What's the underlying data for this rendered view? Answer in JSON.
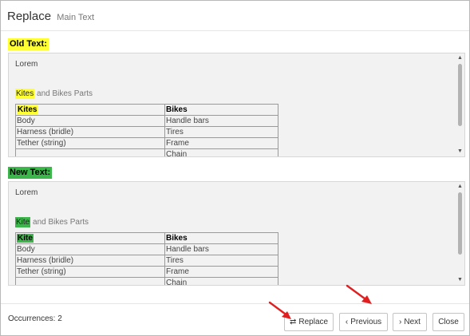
{
  "dialog": {
    "title": "Replace",
    "subtitle": "Main Text"
  },
  "old_section": {
    "label": "Old Text:",
    "lorem": "Lorem",
    "highlight_word": "Kites",
    "rest_text": " and Bikes Parts",
    "table": {
      "header": [
        "Kites",
        "Bikes"
      ],
      "rows": [
        [
          "Body",
          "Handle bars"
        ],
        [
          "Harness (bridle)",
          "Tires"
        ],
        [
          "Tether (string)",
          "Frame"
        ],
        [
          "",
          "Chain"
        ]
      ]
    }
  },
  "new_section": {
    "label": "New Text:",
    "lorem": "Lorem",
    "highlight_word": "Kite",
    "rest_text": " and Bikes Parts",
    "table": {
      "header": [
        "Kite",
        "Bikes"
      ],
      "rows": [
        [
          "Body",
          "Handle bars"
        ],
        [
          "Harness (bridle)",
          "Tires"
        ],
        [
          "Tether (string)",
          "Frame"
        ],
        [
          "",
          "Chain"
        ]
      ]
    }
  },
  "footer": {
    "occurrences": "Occurrences: 2",
    "replace_label": "Replace",
    "previous_label": "Previous",
    "next_label": "Next",
    "close_label": "Close"
  },
  "icons": {
    "scroll_up": "scroll-up-icon",
    "scroll_down": "scroll-down-icon",
    "replace": "swap-arrows-icon",
    "previous": "chevron-left-icon",
    "next": "chevron-right-icon",
    "annotation": "red-arrow-icon"
  },
  "colors": {
    "old_highlight": "#ffff33",
    "new_highlight": "#3cb54a",
    "annotation_arrow": "#e02020"
  }
}
